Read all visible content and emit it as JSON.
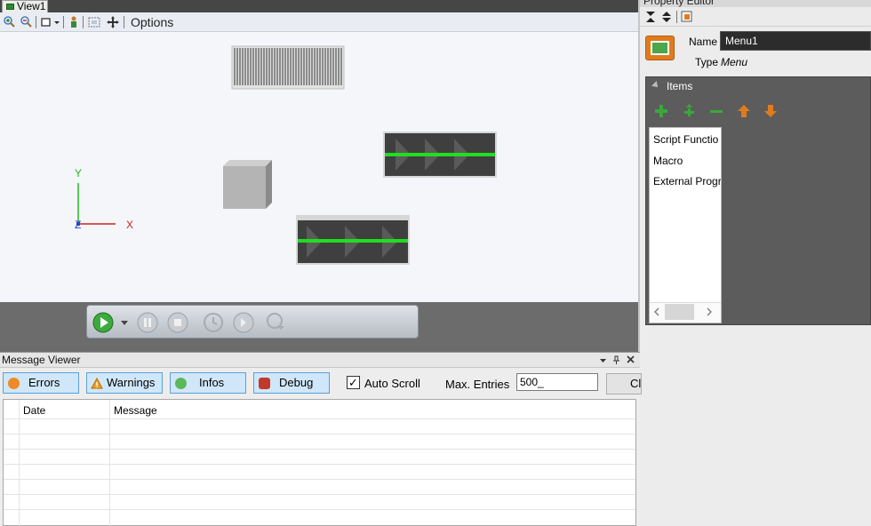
{
  "view": {
    "tab_label": "View1",
    "toolbar": {
      "options_label": "Options"
    },
    "axes": {
      "y": "Y",
      "x": "X",
      "z": "Z"
    }
  },
  "property_editor": {
    "title": "Property Editor",
    "name_label": "Name",
    "name_value": "Menu1",
    "type_label": "Type",
    "type_value": "Menu",
    "items_title": "Items",
    "items": [
      "Script Functio",
      "Macro",
      "External Progr"
    ]
  },
  "message_viewer": {
    "title": "Message Viewer",
    "filters": {
      "errors": "Errors",
      "warnings": "Warnings",
      "infos": "Infos",
      "debug": "Debug"
    },
    "auto_scroll_label": "Auto Scroll",
    "auto_scroll_checked": "✓",
    "max_entries_label": "Max. Entries",
    "max_entries_value": "500_",
    "clear_label": "Clear",
    "columns": {
      "date": "Date",
      "message": "Message"
    }
  },
  "colors": {
    "accent_green": "#22dd22",
    "conveyor_dark": "#3f3f3f",
    "filter_button_bg": "#cfe7f9",
    "name_field_bg": "#2c2c2c"
  }
}
